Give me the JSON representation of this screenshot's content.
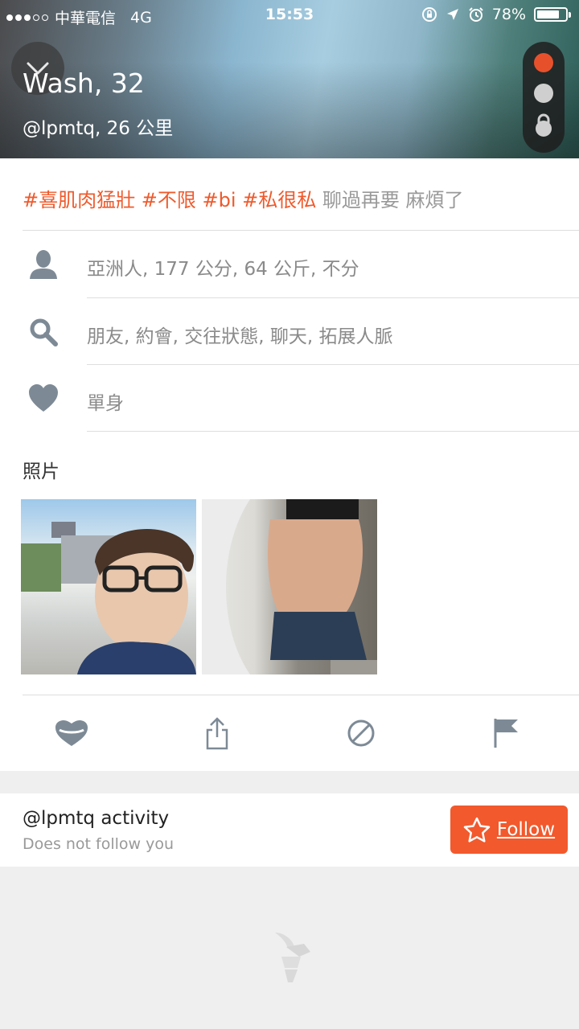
{
  "status_bar": {
    "carrier": "中華電信",
    "network": "4G",
    "time": "15:53",
    "battery": "78%",
    "battery_level": 0.78
  },
  "profile": {
    "name_age": "Wash, 32",
    "handle_distance": "@lpmtq, 26 公里"
  },
  "tags": {
    "hashtags": [
      "#喜肌肉猛壯",
      "#不限",
      "#bi",
      "#私很私"
    ],
    "note": "聊過再要 麻煩了"
  },
  "info": {
    "stats": "亞洲人, 177 公分, 64 公斤, 不分",
    "looking_for": "朋友, 約會, 交往狀態, 聊天, 拓展人脈",
    "relationship": "單身"
  },
  "photos": {
    "title": "照片"
  },
  "activity": {
    "title": "@lpmtq activity",
    "subtitle": "Does not follow you",
    "follow_label": "Follow"
  },
  "colors": {
    "accent": "#ef5a2c",
    "follow_bg": "#f2592c",
    "icon_grey": "#7d8a96",
    "text_grey": "#8a8a8a"
  },
  "icons": {
    "back": "chevron-down-icon",
    "person": "person-icon",
    "search": "search-icon",
    "heart": "heart-icon",
    "woof": "woof-heart-icon",
    "share": "share-icon",
    "block": "block-icon",
    "report": "flag-icon",
    "follow": "star-icon",
    "logo": "hornet-logo-icon"
  }
}
